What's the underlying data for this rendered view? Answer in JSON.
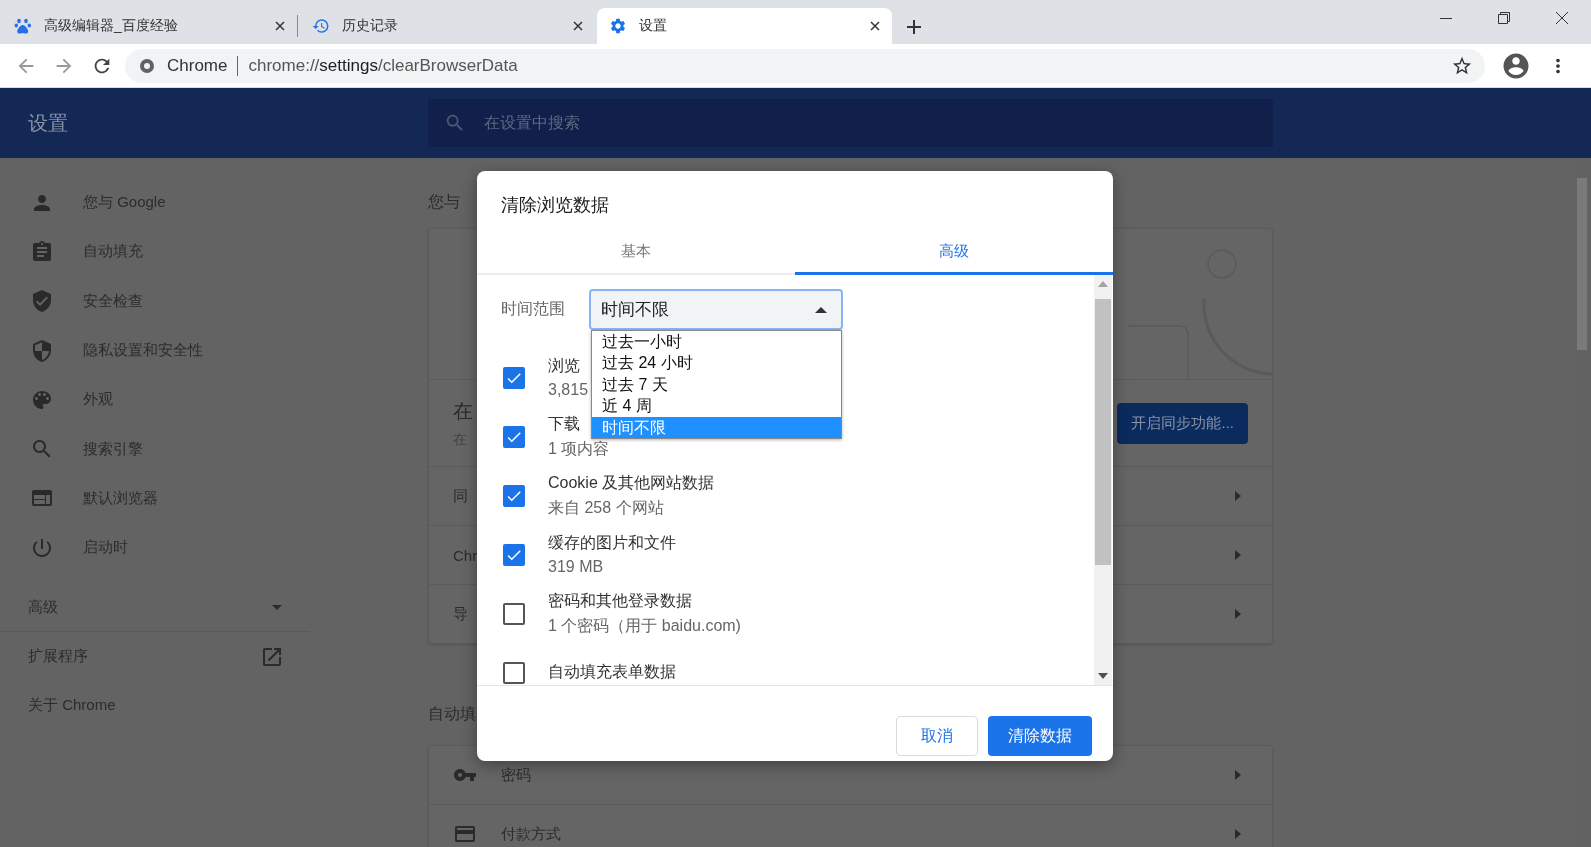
{
  "browser": {
    "tabs": [
      {
        "title": "高级编辑器_百度经验",
        "selected": false
      },
      {
        "title": "历史记录",
        "selected": false
      },
      {
        "title": "设置",
        "selected": true
      }
    ],
    "omnibox": {
      "site_label": "Chrome",
      "url": "chrome://**settings**/clearBrowserData"
    }
  },
  "settings": {
    "title": "设置",
    "search": {
      "placeholder": "在设置中搜索"
    },
    "sidebar": {
      "items": [
        {
          "label": "您与 Google"
        },
        {
          "label": "自动填充"
        },
        {
          "label": "安全检查"
        },
        {
          "label": "隐私设置和安全性"
        },
        {
          "label": "外观"
        },
        {
          "label": "搜索引擎"
        },
        {
          "label": "默认浏览器"
        },
        {
          "label": "启动时"
        }
      ],
      "advanced": {
        "label": "高级",
        "expanded": false
      },
      "links": [
        {
          "label": "扩展程序",
          "kind": "external"
        },
        {
          "label": "关于 Chrome",
          "kind": "plain"
        }
      ]
    },
    "main": {
      "heading": "您与",
      "sync_title": "在",
      "sync_subtitle": "在",
      "sync_button": "开启同步功能...",
      "rows": [
        "同",
        "Chr",
        "导"
      ],
      "autofill_heading": "自动填",
      "autofill_rows": [
        "密码",
        "付款方式"
      ]
    }
  },
  "dialog": {
    "title": "清除浏览数据",
    "tabs": [
      {
        "label": "基本",
        "selected": false
      },
      {
        "label": "高级",
        "selected": true
      }
    ],
    "time_range": {
      "label": "时间范围",
      "value": "时间不限",
      "expanded": true,
      "options": [
        {
          "label": "过去一小时",
          "selected": false
        },
        {
          "label": "过去 24 小时",
          "selected": false
        },
        {
          "label": "过去 7 天",
          "selected": false
        },
        {
          "label": "近 4 周",
          "selected": false
        },
        {
          "label": "时间不限",
          "selected": true
        }
      ]
    },
    "items": [
      {
        "title": "浏览",
        "detail": "3,815",
        "checked": true
      },
      {
        "title": "下载",
        "detail": "1 项内容",
        "checked": true
      },
      {
        "title": "Cookie 及其他网站数据",
        "detail": "来自 258 个网站",
        "checked": true
      },
      {
        "title": "缓存的图片和文件",
        "detail": "319 MB",
        "checked": true
      },
      {
        "title": "密码和其他登录数据",
        "detail": "1 个密码（用于 baidu.com)",
        "checked": false
      },
      {
        "title": "自动填充表单数据",
        "checked": false
      }
    ],
    "buttons": {
      "cancel": "取消",
      "confirm": "清除数据"
    }
  }
}
